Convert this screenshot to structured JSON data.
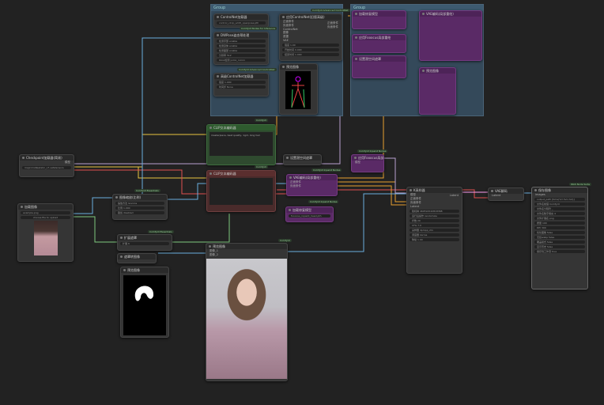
{
  "groups": [
    {
      "title": "Group"
    },
    {
      "title": "Group"
    }
  ],
  "badges": {
    "cn_adv1": "ComfyUI Advanced ControlNet",
    "cn_adv2": "ComfyUI Advanced ControlNet",
    "rgthree": "ComfyUI Nodes for Inference",
    "textenc1": "ComfyUI",
    "textenc2": "ComfyUI",
    "inpaint1": "ComfyUI Inpaint Nodes",
    "inpaint2": "ComfyUI Inpaint Nodes",
    "inpaint3": "ComfyUI Inpaint Nodes",
    "layer": "ComfyUI_LayerStyle",
    "essentials": "ComfyUI Essentials",
    "mask": "ComfyUI Essentials",
    "preview": "ComfyUI",
    "was": "WAS Node Suite"
  },
  "nodes": {
    "cn_loader": {
      "title": "ControlNet加载器",
      "value": "control_v11p_sd15_openpose.pth"
    },
    "cn_apply": {
      "title": "应用ControlNet(旧版高级)",
      "inputs": [
        "正面条件",
        "负面条件",
        "ControlNet",
        "图像",
        "遮罩",
        "VAE"
      ],
      "widgets": [
        "强度 1.00",
        "开始时间 0.000",
        "结束时间 1.000"
      ],
      "outputs": [
        "正面条件",
        "负面条件"
      ]
    },
    "pose": {
      "title": "DWPose姿态预处理",
      "inputs": [
        "图像"
      ],
      "widgets": [
        "检测手部 enable",
        "检测身体 enable",
        "检测面部 enable",
        "分辨率 512",
        "bbox检测 yolox_l.onnx",
        "姿态估计 dw-ll_ucoco_384.onnx"
      ]
    },
    "cn_loader2": {
      "title": "高级ControlNet加载器",
      "widgets": [
        "强度 1.000",
        "时间步 None"
      ]
    },
    "preview_pose": {
      "title": "预览图像"
    },
    "ckpt": {
      "title": "Checkpoint加载器(简易)",
      "outputs": [
        "模型",
        "CLIP",
        "VAE"
      ],
      "value": "majicmixRealistic_v7.safetensors"
    },
    "load_image": {
      "title": "加载图像",
      "outputs": [
        "图像",
        "遮罩"
      ],
      "value": "example.png",
      "upload": "choose file to upload"
    },
    "pos_prompt": {
      "title": "CLIP文本编码器",
      "text": "masterpiece, best quality, 1girl, long hair"
    },
    "neg_prompt": {
      "title": "CLIP文本编码器",
      "text": ""
    },
    "scale": {
      "title": "图像缩放(比例)",
      "widgets": [
        "缩放方法 lanczos",
        "比例 1.000",
        "裁剪 disabled",
        "倍数 8"
      ]
    },
    "latent": {
      "title": "设置潜空间遮罩"
    },
    "vae_encode": {
      "title": "VAE编码(局部重绘)",
      "inputs": [
        "正面条件",
        "负面条件",
        "VAE",
        "像素",
        "遮罩"
      ],
      "outputs": [
        "正面条件",
        "负面条件",
        "Latent",
        "遮罩"
      ]
    },
    "inpaint_model": {
      "title": "加载修复模型",
      "widgets": [
        "fooocus_inpaint_head.pth",
        "inpaint_v26.fooocus.patch"
      ]
    },
    "apply_inpaint": {
      "title": "应用Fooocus局部重绘",
      "inputs": [
        "模型",
        "修复模型",
        "Latent"
      ]
    },
    "grow_mask": {
      "title": "扩展遮罩",
      "widgets": [
        "扩展 6"
      ]
    },
    "mask_to_image": {
      "title": "遮罩转图像"
    },
    "preview_mask": {
      "title": "预览图像"
    },
    "preview_result": {
      "title": "预览图像",
      "inputs": [
        "图像_1",
        "图像_2"
      ]
    },
    "ksampler": {
      "title": "K采样器",
      "inputs": [
        "模型",
        "正面条件",
        "负面条件",
        "Latent"
      ],
      "widgets": [
        "随机种 460591542818368",
        "运行后操作 randomize",
        "步数 20",
        "CFG 7.0",
        "采样器 dpmpp_2m",
        "调度器 karras",
        "降噪 1.00"
      ],
      "output": "Latent"
    },
    "vae_decode": {
      "title": "VAE解码",
      "inputs": [
        "Latent",
        "VAE"
      ],
      "output": "图像"
    },
    "save": {
      "title": "保存图像",
      "input": "images",
      "widgets": [
        "output_path [time(%Y-%m-%d)]",
        "文件名前缀 ComfyUI",
        "文件名分隔符 _",
        "文件名数字填充 4",
        "文件扩展名 png",
        "质量 100",
        "DPI 300",
        "优化图像 false",
        "无损webp false",
        "覆盖模式 false",
        "显示历史 false",
        "保存到工作流 true"
      ]
    }
  }
}
